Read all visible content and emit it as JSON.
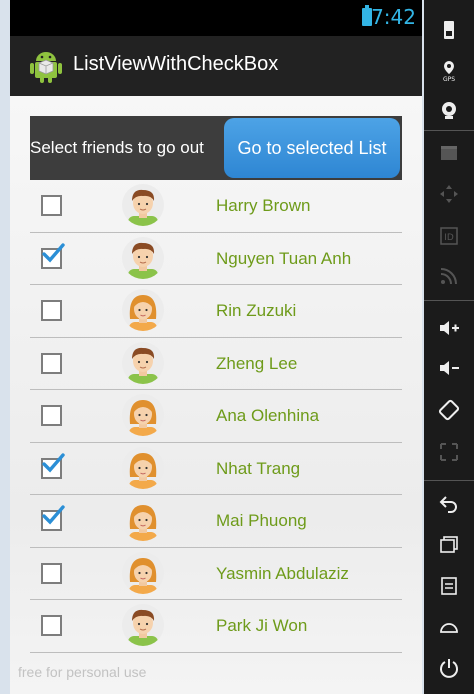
{
  "status_bar": {
    "time": "7:42"
  },
  "action_bar": {
    "title": "ListViewWithCheckBox"
  },
  "header": {
    "prompt": "Select friends to go out",
    "button_label": "Go to selected List"
  },
  "friends": [
    {
      "name": "Harry Brown",
      "checked": false,
      "avatar": "male"
    },
    {
      "name": "Nguyen Tuan Anh",
      "checked": true,
      "avatar": "male"
    },
    {
      "name": "Rin Zuzuki",
      "checked": false,
      "avatar": "female"
    },
    {
      "name": "Zheng Lee",
      "checked": false,
      "avatar": "male"
    },
    {
      "name": "Ana Olenhina",
      "checked": false,
      "avatar": "female"
    },
    {
      "name": "Nhat Trang",
      "checked": true,
      "avatar": "female"
    },
    {
      "name": "Mai Phuong",
      "checked": true,
      "avatar": "female"
    },
    {
      "name": "Yasmin Abdulaziz",
      "checked": false,
      "avatar": "female"
    },
    {
      "name": "Park Ji Won",
      "checked": false,
      "avatar": "male"
    }
  ],
  "watermark": "free for personal use",
  "emulator_controls": [
    "sim-icon",
    "gps-icon",
    "camera-icon",
    "video-icon",
    "dpad-icon",
    "id-icon",
    "rss-icon",
    "volume-up-icon",
    "volume-down-icon",
    "rotate-icon",
    "fullscreen-icon",
    "back-icon",
    "recent-apps-icon",
    "menu-icon",
    "home-icon",
    "power-icon"
  ],
  "control_labels": {
    "gps": "GPS",
    "id": "ID"
  },
  "colors": {
    "accent": "#33b5e5",
    "name_text": "#6e9b1a",
    "button": "#2e86d3",
    "check": "#2b8fd6"
  }
}
